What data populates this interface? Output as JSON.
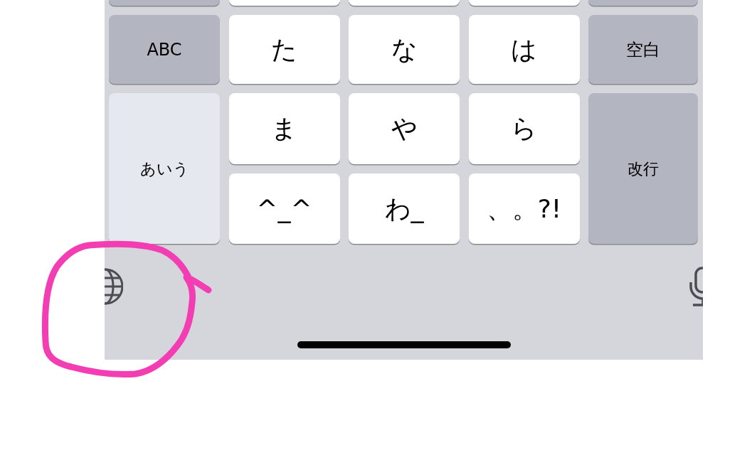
{
  "keyboard": {
    "top_row": [
      {
        "kind": "function"
      },
      {
        "kind": "letter"
      },
      {
        "kind": "letter"
      },
      {
        "kind": "letter"
      },
      {
        "kind": "function"
      }
    ],
    "keys": [
      {
        "label": "ABC",
        "kind": "function",
        "span": false,
        "selected": false
      },
      {
        "label": "た",
        "kind": "letter",
        "span": false,
        "selected": false
      },
      {
        "label": "な",
        "kind": "letter",
        "span": false,
        "selected": false
      },
      {
        "label": "は",
        "kind": "letter",
        "span": false,
        "selected": false
      },
      {
        "label": "空白",
        "kind": "function",
        "span": false,
        "selected": false
      },
      {
        "label": "あいう",
        "kind": "function",
        "span": true,
        "selected": true
      },
      {
        "label": "ま",
        "kind": "letter",
        "span": false,
        "selected": false
      },
      {
        "label": "や",
        "kind": "letter",
        "span": false,
        "selected": false
      },
      {
        "label": "ら",
        "kind": "letter",
        "span": false,
        "selected": false
      },
      {
        "label": "改行",
        "kind": "function",
        "span": true,
        "selected": false
      },
      {
        "label": "^_^",
        "kind": "letter",
        "span": false,
        "selected": false
      },
      {
        "label": "わ_",
        "kind": "letter",
        "span": false,
        "selected": false
      },
      {
        "label": "、。?!",
        "kind": "letter",
        "span": false,
        "selected": false
      }
    ]
  },
  "annotations": [
    {
      "kind": "freehand-circle",
      "color": "#f23db3"
    }
  ]
}
